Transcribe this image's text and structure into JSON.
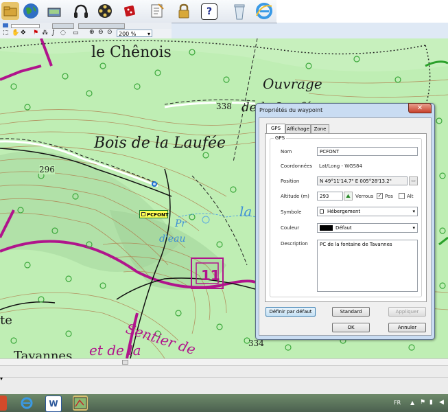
{
  "toolbar": {
    "zoom_value": "200 %",
    "icons": [
      "folder-icon",
      "globe-icon",
      "gps-device-icon",
      "headphones-icon",
      "film-reel-icon",
      "dice-icon",
      "checklist-icon",
      "lock-icon",
      "help-icon",
      "recycle-bin-icon",
      "internet-explorer-icon"
    ],
    "help_glyph": "?"
  },
  "map": {
    "labels": {
      "chenois": "le Chênois",
      "ouvrage": "Ouvrage",
      "ouvrage2": "de la Laufée",
      "bois": "Bois de la Laufée",
      "alt338": "338",
      "alt296": "296",
      "alt334": "334",
      "la_fo": "la Fo",
      "pr": "Pr",
      "deau": "d'eau",
      "num11": "11",
      "sentier": "Sentier de",
      "etdela": "et de la",
      "vannes": "Tavannes",
      "te": "te"
    },
    "waypoint_label": "PCFONT"
  },
  "dialog": {
    "title": "Propriétés du waypoint",
    "close_glyph": "✕",
    "tabs": [
      "GPS",
      "Affichage",
      "Zone"
    ],
    "group_label": "GPS",
    "fields": {
      "nom_label": "Nom",
      "nom_value": "PCFONT",
      "coord_label": "Coordonnées",
      "coord_value": "Lat/Long - WGS84",
      "position_label": "Position",
      "position_value": "N 49°11'14.7\" E 005°28'13.2\"",
      "altitude_label": "Altitude (m)",
      "altitude_value": "293",
      "verrous_label": "Verrous",
      "pos_label": "Pos",
      "alt_label": "Alt",
      "symbole_label": "Symbole",
      "symbole_value": "Hébergement",
      "couleur_label": "Couleur",
      "couleur_value": "Défaut",
      "description_label": "Description",
      "description_value": "PC de la fontaine de Tavannes"
    },
    "checks": {
      "pos": true,
      "alt": false
    },
    "buttons": {
      "defaut": "Définir par défaut",
      "standard": "Standard",
      "appliquer": "Appliquer",
      "ok": "OK",
      "annuler": "Annuler"
    }
  },
  "taskbar": {
    "lang": "FR",
    "word_glyph": "W"
  },
  "colors": {
    "map_green": "#bfeeb4",
    "road_purple": "#b0148c",
    "contour_brown": "#b07a4a",
    "dialog_frame": "#c9dcf2",
    "close_red": "#c8402b",
    "waypoint_yellow": "#ffff55"
  }
}
